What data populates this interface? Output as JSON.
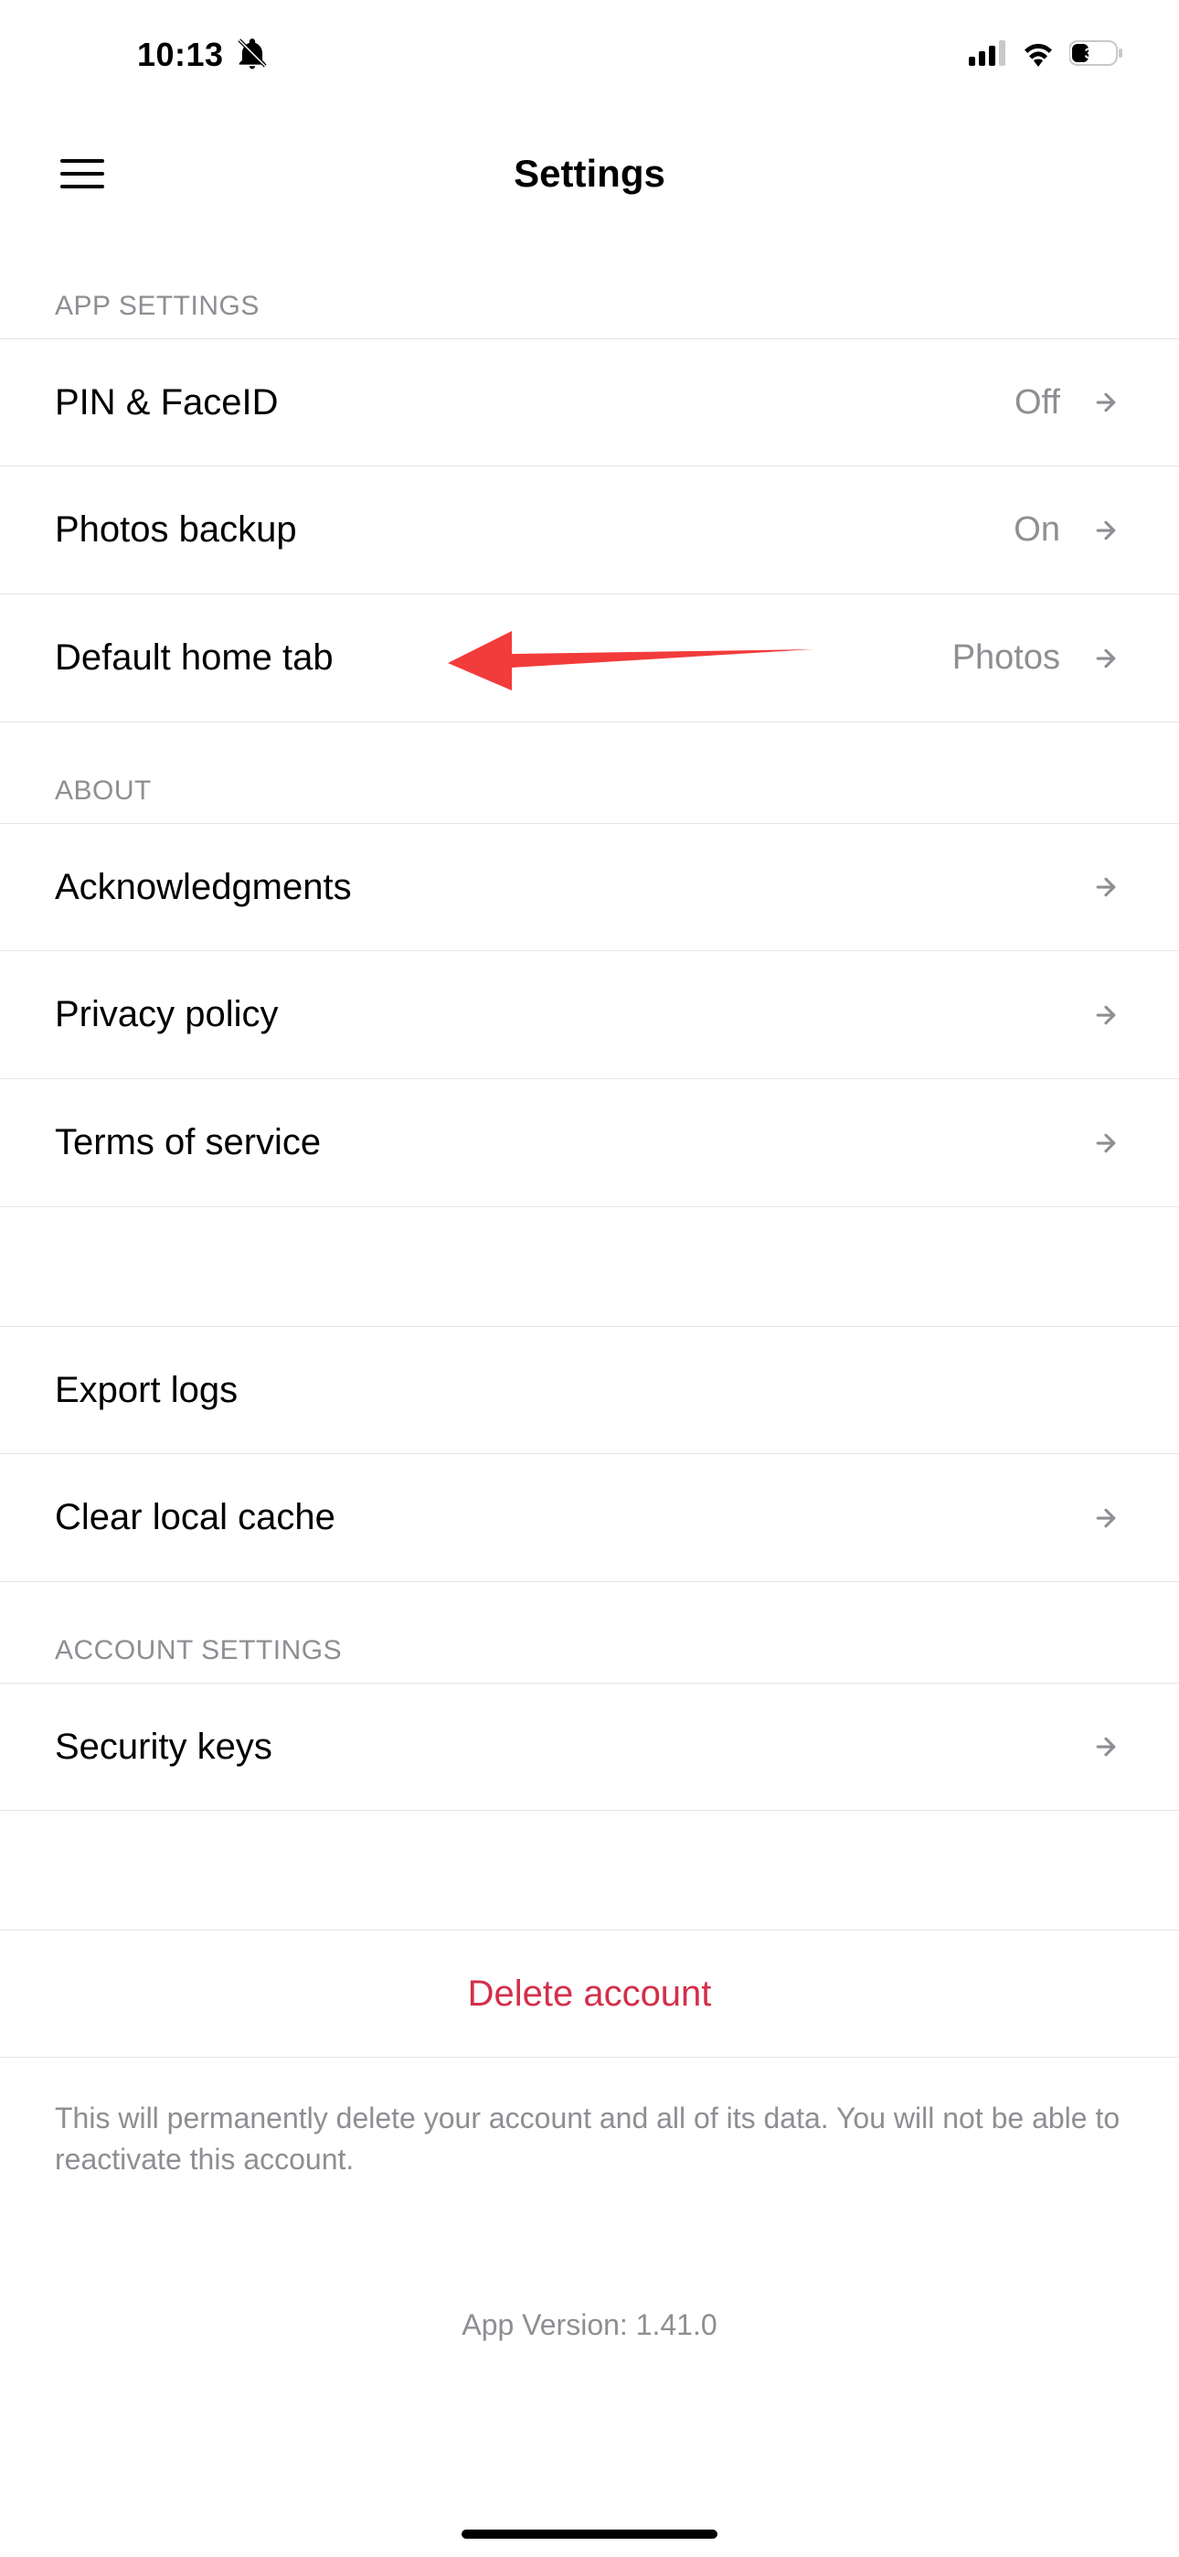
{
  "status_bar": {
    "time": "10:13",
    "battery_percent": "35"
  },
  "nav": {
    "title": "Settings"
  },
  "sections": {
    "app_settings": {
      "header": "APP SETTINGS",
      "items": [
        {
          "label": "PIN & FaceID",
          "value": "Off"
        },
        {
          "label": "Photos backup",
          "value": "On"
        },
        {
          "label": "Default home tab",
          "value": "Photos"
        }
      ]
    },
    "about": {
      "header": "ABOUT",
      "items": [
        {
          "label": "Acknowledgments"
        },
        {
          "label": "Privacy policy"
        },
        {
          "label": "Terms of service"
        }
      ]
    },
    "debug": {
      "items": [
        {
          "label": "Export logs"
        },
        {
          "label": "Clear local cache"
        }
      ]
    },
    "account_settings": {
      "header": "ACCOUNT SETTINGS",
      "items": [
        {
          "label": "Security keys"
        }
      ]
    },
    "delete": {
      "label": "Delete account",
      "footer": "This will permanently delete your account and all of its data. You will not be able to reactivate this account."
    }
  },
  "app_version": "App Version: 1.41.0"
}
